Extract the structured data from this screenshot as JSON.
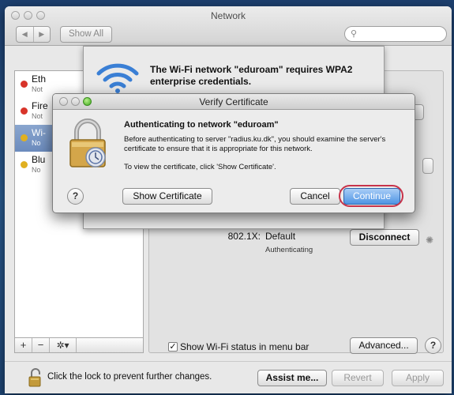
{
  "window": {
    "title": "Network"
  },
  "toolbar": {
    "back_glyph": "◀",
    "forward_glyph": "▶",
    "show_all_label": "Show All",
    "search_placeholder": "",
    "search_icon": "search-icon"
  },
  "sidebar": {
    "items": [
      {
        "name": "Eth",
        "sub": "Not",
        "status_color": "#d8342a"
      },
      {
        "name": "Fire",
        "sub": "Not",
        "status_color": "#d8342a"
      },
      {
        "name": "Wi-",
        "sub": "No",
        "status_color": "#e0b020",
        "selected": true
      },
      {
        "name": "Blu",
        "sub": "No",
        "status_color": "#e0b020"
      }
    ],
    "tools": {
      "add": "+",
      "remove": "−",
      "gear": "✲▾"
    }
  },
  "sheet": {
    "title": "The Wi-Fi network \"eduroam\" requires WPA2 enterprise credentials."
  },
  "dialog": {
    "title": "Verify Certificate",
    "heading": "Authenticating to network \"eduroam\"",
    "body": "Before authenticating to server \"radius.ku.dk\", you should examine the server's certificate to ensure that it is appropriate for this network.",
    "instruction": "To view the certificate, click 'Show Certificate'.",
    "help_label": "?",
    "show_certificate_label": "Show Certificate",
    "cancel_label": "Cancel",
    "continue_label": "Continue"
  },
  "details": {
    "x8021_label": "802.1X:",
    "x8021_value": "Default",
    "status": "Authenticating",
    "disconnect_label": "Disconnect",
    "show_wifi_status_label": "Show Wi-Fi status in menu bar",
    "show_wifi_status_checked": true,
    "check_glyph": "✓",
    "advanced_label": "Advanced...",
    "help_label": "?"
  },
  "bottom": {
    "lock_text": "Click the lock to prevent further changes.",
    "assist_label": "Assist me...",
    "revert_label": "Revert",
    "apply_label": "Apply"
  },
  "colors": {
    "accent": "#4f94e4",
    "focus_ring": "#c7334a",
    "selection": "#7a97c8"
  }
}
